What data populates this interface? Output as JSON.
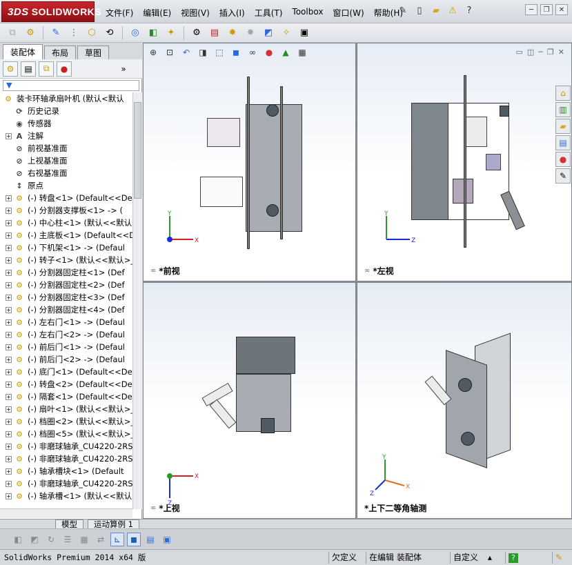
{
  "app": {
    "brand": "SOLIDWORKS",
    "brand_mark": "3DS"
  },
  "menu": [
    "文件(F)",
    "编辑(E)",
    "视图(V)",
    "插入(I)",
    "工具(T)",
    "Toolbox",
    "窗口(W)",
    "帮助(H)"
  ],
  "left_tabs": [
    "装配体",
    "布局",
    "草图"
  ],
  "tree": {
    "root": "装卡环轴承扇叶机  (默认<默认",
    "features": [
      "历史记录",
      "传感器",
      "注解",
      "前视基准面",
      "上视基准面",
      "右视基准面",
      "原点"
    ],
    "parts": [
      "(-) 转盘<1> (Default<<De",
      "(-) 分割器支撑板<1> -> (",
      "(-) 中心柱<1> (默认<<默认",
      "(-) 主底板<1> (Default<<D",
      "(-) 下机架<1> -> (Defaul",
      "(-) 转子<1> (默认<<默认>_",
      "(-) 分割器固定柱<1> (Def",
      "(-) 分割器固定柱<2> (Def",
      "(-) 分割器固定柱<3> (Def",
      "(-) 分割器固定柱<4> (Def",
      "(-) 左右门<1> -> (Defaul",
      "(-) 左右门<2> -> (Defaul",
      "(-) 前后门<1> -> (Defaul",
      "(-) 前后门<2> -> (Defaul",
      "(-) 底门<1> (Default<<De",
      "(-) 转盘<2> (Default<<De",
      "(-) 隔套<1> (Default<<De",
      "(-) 扇叶<1> (默认<<默认>_",
      "(-) 档圈<2> (默认<<默认>_",
      "(-) 档圈<5> (默认<<默认>_",
      "(-) 非磨球轴承_CU4220-2RS",
      "(-) 非磨球轴承_CU4220-2RS",
      "(-) 轴承槽块<1> (Default",
      "(-) 非磨球轴承_CU4220-2RS",
      "(-) 轴承槽<1> (默认<<默认"
    ]
  },
  "viewports": [
    {
      "label": "*前视",
      "axis_h": "X",
      "axis_v": "Y"
    },
    {
      "label": "*左视",
      "axis_h": "Z",
      "axis_v": "Y"
    },
    {
      "label": "*上视",
      "axis_h": "X",
      "axis_v": "Z"
    },
    {
      "label": "*上下二等角轴测",
      "axis_h": "X",
      "axis_v": "Y",
      "axis_z": "Z"
    }
  ],
  "bottom_tabs": [
    "模型",
    "运动算例 1"
  ],
  "status": {
    "product": "SolidWorks Premium 2014 x64 版",
    "defined": "欠定义",
    "editing": "在编辑 装配体",
    "custom": "自定义",
    "help": "?"
  },
  "icons": [
    "home-icon",
    "search-icon",
    "filter-icon",
    "question-icon",
    "warning-icon"
  ]
}
